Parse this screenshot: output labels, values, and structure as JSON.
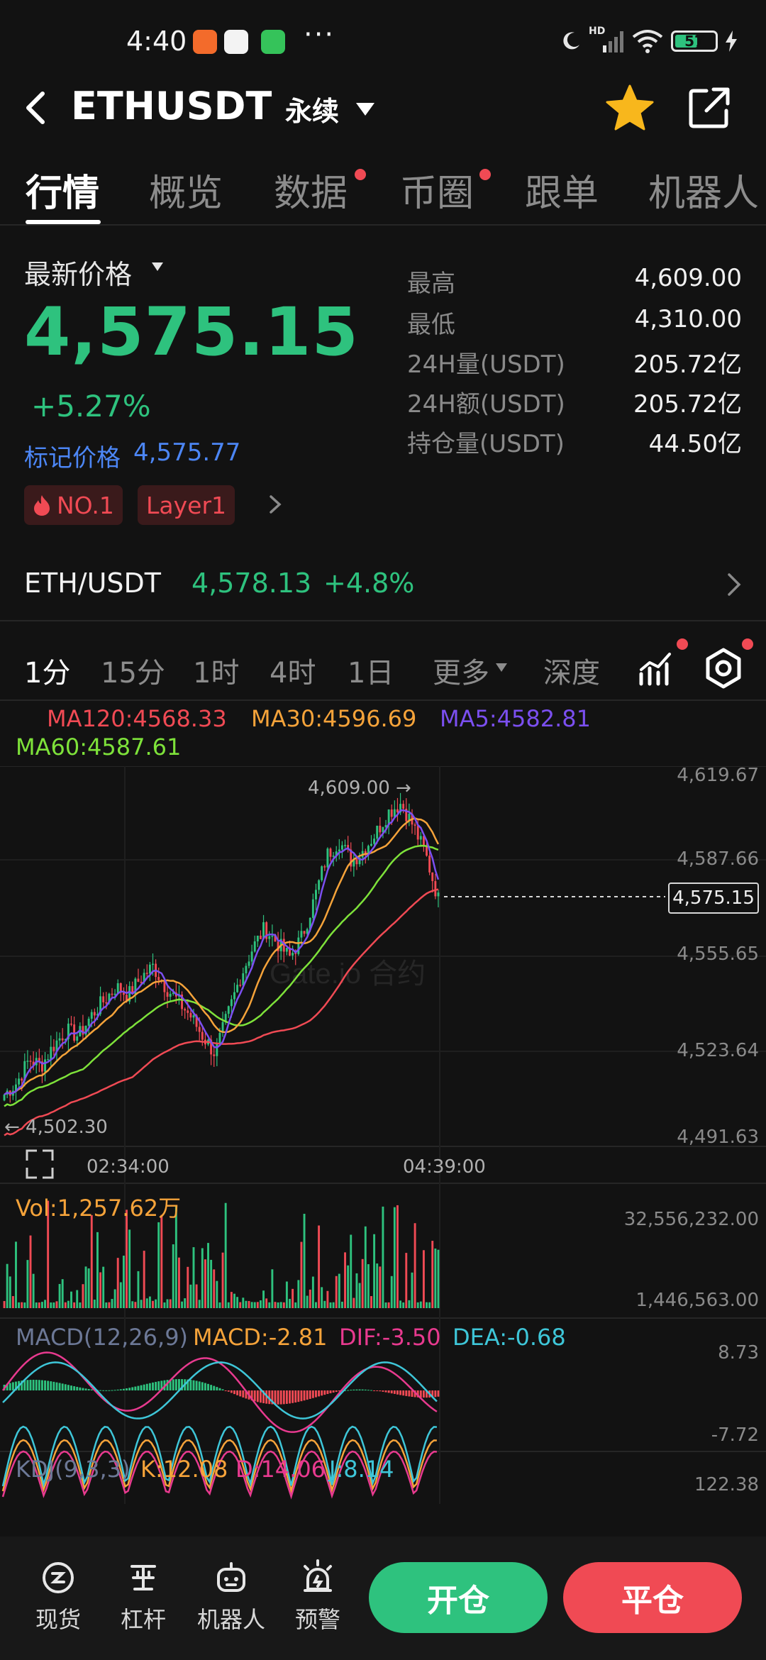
{
  "status_bar": {
    "time": "4:40",
    "dots": "···",
    "battery": "57",
    "network": "HD"
  },
  "header": {
    "pair": "ETHUSDT",
    "contract_type": "永续"
  },
  "tabs": [
    {
      "label": "行情",
      "active": true,
      "dot": false
    },
    {
      "label": "概览",
      "active": false,
      "dot": false
    },
    {
      "label": "数据",
      "active": false,
      "dot": true
    },
    {
      "label": "币圈",
      "active": false,
      "dot": true
    },
    {
      "label": "跟单",
      "active": false,
      "dot": false
    },
    {
      "label": "机器人",
      "active": false,
      "dot": false
    }
  ],
  "price": {
    "label": "最新价格",
    "last": "4,575.15",
    "change_pct": "+5.27%",
    "mark_label": "标记价格",
    "mark_value": "4,575.77",
    "tags": [
      "NO.1",
      "Layer1"
    ]
  },
  "stats": [
    {
      "label": "最高",
      "value": "4,609.00"
    },
    {
      "label": "最低",
      "value": "4,310.00"
    },
    {
      "label": "24H量(USDT)",
      "value": "205.72亿"
    },
    {
      "label": "24H额(USDT)",
      "value": "205.72亿"
    },
    {
      "label": "持仓量(USDT)",
      "value": "44.50亿"
    }
  ],
  "spot": {
    "pair": "ETH/USDT",
    "price": "4,578.13",
    "change": "+4.8%"
  },
  "intervals": [
    {
      "label": "1分",
      "active": true
    },
    {
      "label": "15分",
      "active": false
    },
    {
      "label": "1时",
      "active": false
    },
    {
      "label": "4时",
      "active": false
    },
    {
      "label": "1日",
      "active": false
    },
    {
      "label": "更多",
      "active": false
    },
    {
      "label": "深度",
      "active": false
    }
  ],
  "ma_legend": {
    "ma120": "MA120:4568.33",
    "ma30": "MA30:4596.69",
    "ma5": "MA5:4582.81",
    "ma60": "MA60:4587.61"
  },
  "colors": {
    "up": "#2ec27e",
    "down": "#f04a54",
    "ma120": "#f04a54",
    "ma30": "#f5a33a",
    "ma5": "#7b4ff0",
    "ma60": "#7ee23a"
  },
  "chart_data": {
    "type": "candlestick",
    "title": "",
    "y_axis_ticks": [
      "4,619.67",
      "4,587.66",
      "4,555.65",
      "4,523.64",
      "4,491.63"
    ],
    "x_axis_ticks": [
      "02:34:00",
      "04:39:00"
    ],
    "current_price_tag": "4,575.15",
    "high_marker": "4,609.00 →",
    "low_marker": "← 4,502.30",
    "close_path": [
      4508,
      4512,
      4520,
      4518,
      4525,
      4530,
      4528,
      4535,
      4540,
      4545,
      4542,
      4548,
      4552,
      4545,
      4540,
      4535,
      4528,
      4522,
      4535,
      4548,
      4558,
      4565,
      4560,
      4555,
      4562,
      4575,
      4590,
      4595,
      4588,
      4592,
      4598,
      4605,
      4608,
      4600,
      4590,
      4575
    ],
    "watermark": "Gate.io 合约"
  },
  "volume": {
    "label": "Vol:1,257.62万",
    "max": "32,556,232.00",
    "min": "1,446,563.00"
  },
  "macd": {
    "params": "MACD(12,26,9)",
    "macd": "MACD:-2.81",
    "dif": "DIF:-3.50",
    "dea": "DEA:-0.68",
    "max": "8.73",
    "min": "-7.72"
  },
  "kdj": {
    "params": "KDJ(9,3,3)",
    "k": "K:12.08",
    "d": "D:14.06",
    "j": "J:8.14",
    "max": "122.38"
  },
  "bottom_nav": {
    "items": [
      {
        "label": "现货",
        "icon": "spot-icon"
      },
      {
        "label": "杠杆",
        "icon": "margin-icon"
      },
      {
        "label": "机器人",
        "icon": "robot-icon"
      },
      {
        "label": "预警",
        "icon": "alarm-icon"
      }
    ],
    "open_label": "开仓",
    "close_label": "平仓"
  }
}
